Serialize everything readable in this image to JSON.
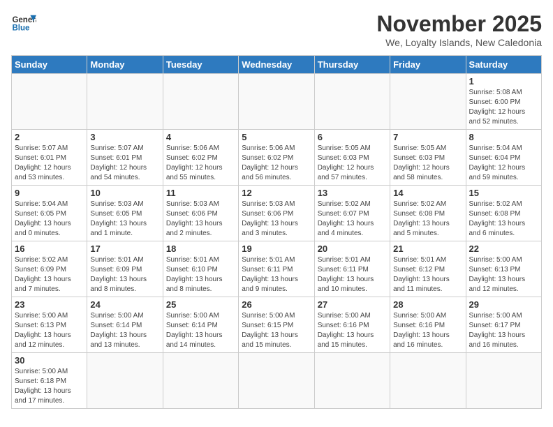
{
  "logo": {
    "line1": "General",
    "line2": "Blue"
  },
  "title": "November 2025",
  "location": "We, Loyalty Islands, New Caledonia",
  "weekdays": [
    "Sunday",
    "Monday",
    "Tuesday",
    "Wednesday",
    "Thursday",
    "Friday",
    "Saturday"
  ],
  "weeks": [
    [
      {
        "day": "",
        "info": ""
      },
      {
        "day": "",
        "info": ""
      },
      {
        "day": "",
        "info": ""
      },
      {
        "day": "",
        "info": ""
      },
      {
        "day": "",
        "info": ""
      },
      {
        "day": "",
        "info": ""
      },
      {
        "day": "1",
        "info": "Sunrise: 5:08 AM\nSunset: 6:00 PM\nDaylight: 12 hours\nand 52 minutes."
      }
    ],
    [
      {
        "day": "2",
        "info": "Sunrise: 5:07 AM\nSunset: 6:01 PM\nDaylight: 12 hours\nand 53 minutes."
      },
      {
        "day": "3",
        "info": "Sunrise: 5:07 AM\nSunset: 6:01 PM\nDaylight: 12 hours\nand 54 minutes."
      },
      {
        "day": "4",
        "info": "Sunrise: 5:06 AM\nSunset: 6:02 PM\nDaylight: 12 hours\nand 55 minutes."
      },
      {
        "day": "5",
        "info": "Sunrise: 5:06 AM\nSunset: 6:02 PM\nDaylight: 12 hours\nand 56 minutes."
      },
      {
        "day": "6",
        "info": "Sunrise: 5:05 AM\nSunset: 6:03 PM\nDaylight: 12 hours\nand 57 minutes."
      },
      {
        "day": "7",
        "info": "Sunrise: 5:05 AM\nSunset: 6:03 PM\nDaylight: 12 hours\nand 58 minutes."
      },
      {
        "day": "8",
        "info": "Sunrise: 5:04 AM\nSunset: 6:04 PM\nDaylight: 12 hours\nand 59 minutes."
      }
    ],
    [
      {
        "day": "9",
        "info": "Sunrise: 5:04 AM\nSunset: 6:05 PM\nDaylight: 13 hours\nand 0 minutes."
      },
      {
        "day": "10",
        "info": "Sunrise: 5:03 AM\nSunset: 6:05 PM\nDaylight: 13 hours\nand 1 minute."
      },
      {
        "day": "11",
        "info": "Sunrise: 5:03 AM\nSunset: 6:06 PM\nDaylight: 13 hours\nand 2 minutes."
      },
      {
        "day": "12",
        "info": "Sunrise: 5:03 AM\nSunset: 6:06 PM\nDaylight: 13 hours\nand 3 minutes."
      },
      {
        "day": "13",
        "info": "Sunrise: 5:02 AM\nSunset: 6:07 PM\nDaylight: 13 hours\nand 4 minutes."
      },
      {
        "day": "14",
        "info": "Sunrise: 5:02 AM\nSunset: 6:08 PM\nDaylight: 13 hours\nand 5 minutes."
      },
      {
        "day": "15",
        "info": "Sunrise: 5:02 AM\nSunset: 6:08 PM\nDaylight: 13 hours\nand 6 minutes."
      }
    ],
    [
      {
        "day": "16",
        "info": "Sunrise: 5:02 AM\nSunset: 6:09 PM\nDaylight: 13 hours\nand 7 minutes."
      },
      {
        "day": "17",
        "info": "Sunrise: 5:01 AM\nSunset: 6:09 PM\nDaylight: 13 hours\nand 8 minutes."
      },
      {
        "day": "18",
        "info": "Sunrise: 5:01 AM\nSunset: 6:10 PM\nDaylight: 13 hours\nand 8 minutes."
      },
      {
        "day": "19",
        "info": "Sunrise: 5:01 AM\nSunset: 6:11 PM\nDaylight: 13 hours\nand 9 minutes."
      },
      {
        "day": "20",
        "info": "Sunrise: 5:01 AM\nSunset: 6:11 PM\nDaylight: 13 hours\nand 10 minutes."
      },
      {
        "day": "21",
        "info": "Sunrise: 5:01 AM\nSunset: 6:12 PM\nDaylight: 13 hours\nand 11 minutes."
      },
      {
        "day": "22",
        "info": "Sunrise: 5:00 AM\nSunset: 6:13 PM\nDaylight: 13 hours\nand 12 minutes."
      }
    ],
    [
      {
        "day": "23",
        "info": "Sunrise: 5:00 AM\nSunset: 6:13 PM\nDaylight: 13 hours\nand 12 minutes."
      },
      {
        "day": "24",
        "info": "Sunrise: 5:00 AM\nSunset: 6:14 PM\nDaylight: 13 hours\nand 13 minutes."
      },
      {
        "day": "25",
        "info": "Sunrise: 5:00 AM\nSunset: 6:14 PM\nDaylight: 13 hours\nand 14 minutes."
      },
      {
        "day": "26",
        "info": "Sunrise: 5:00 AM\nSunset: 6:15 PM\nDaylight: 13 hours\nand 15 minutes."
      },
      {
        "day": "27",
        "info": "Sunrise: 5:00 AM\nSunset: 6:16 PM\nDaylight: 13 hours\nand 15 minutes."
      },
      {
        "day": "28",
        "info": "Sunrise: 5:00 AM\nSunset: 6:16 PM\nDaylight: 13 hours\nand 16 minutes."
      },
      {
        "day": "29",
        "info": "Sunrise: 5:00 AM\nSunset: 6:17 PM\nDaylight: 13 hours\nand 16 minutes."
      }
    ],
    [
      {
        "day": "30",
        "info": "Sunrise: 5:00 AM\nSunset: 6:18 PM\nDaylight: 13 hours\nand 17 minutes."
      },
      {
        "day": "",
        "info": ""
      },
      {
        "day": "",
        "info": ""
      },
      {
        "day": "",
        "info": ""
      },
      {
        "day": "",
        "info": ""
      },
      {
        "day": "",
        "info": ""
      },
      {
        "day": "",
        "info": ""
      }
    ]
  ]
}
